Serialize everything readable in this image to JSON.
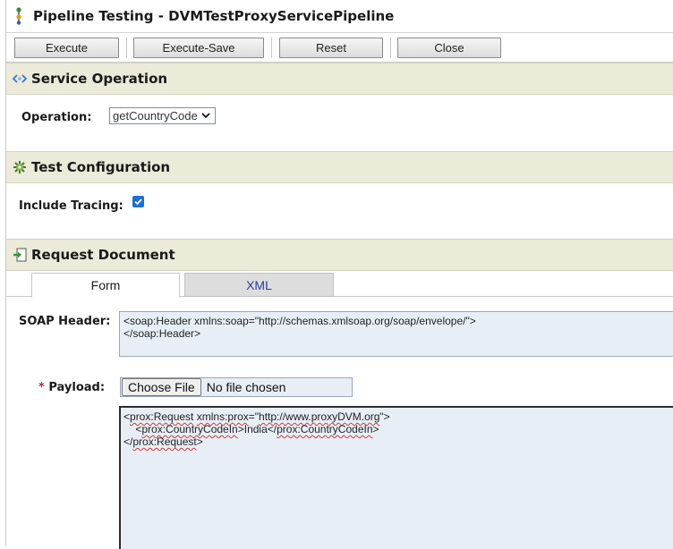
{
  "window": {
    "title": "Pipeline Testing - DVMTestProxyServicePipeline",
    "icon": "pipeline-icon"
  },
  "toolbar": {
    "execute_label": "Execute",
    "execute_save_label": "Execute-Save",
    "reset_label": "Reset",
    "close_label": "Close"
  },
  "service_operation": {
    "header": "Service Operation",
    "icon": "service-operation-icon",
    "operation_label": "Operation:",
    "operation_value": "getCountryCode"
  },
  "test_configuration": {
    "header": "Test Configuration",
    "icon": "gear-icon",
    "include_tracing_label": "Include Tracing:",
    "include_tracing_checked": true
  },
  "request_document": {
    "header": "Request Document",
    "icon": "import-document-icon",
    "tabs": [
      {
        "label": "Form",
        "active": true
      },
      {
        "label": "XML",
        "active": false
      }
    ],
    "soap_header_label": "SOAP Header:",
    "soap_header_lines": [
      "<soap:Header xmlns:soap=\"http://schemas.xmlsoap.org/soap/envelope/\">",
      "</soap:Header>"
    ],
    "payload_required_mark": "*",
    "payload_label": "Payload:",
    "choose_file_label": "Choose File",
    "file_status": "No file chosen",
    "payload_lines": {
      "line1_open": "<",
      "line1_tag": "prox:Request",
      "line1_space": " ",
      "line1_attr": "xmlns:prox",
      "line1_eq": "=\"",
      "line1_url": "http://www.proxyDVM.org",
      "line1_close": "\">",
      "line2_indent": "    <",
      "line2_tag": "prox:CountryCodeIn",
      "line2_mid": ">India</",
      "line2_tag2": "prox:CountryCodeIn",
      "line2_close": ">",
      "line3_open": "</",
      "line3_tag": "prox:Request",
      "line3_close": ">"
    }
  },
  "colors": {
    "section_header_bg": "#ecead9",
    "textbox_bg": "#e8eef6",
    "checkbox_blue": "#1b6fd6",
    "required_red": "#c0282d",
    "xml_tab_text": "#2c3a9e"
  }
}
